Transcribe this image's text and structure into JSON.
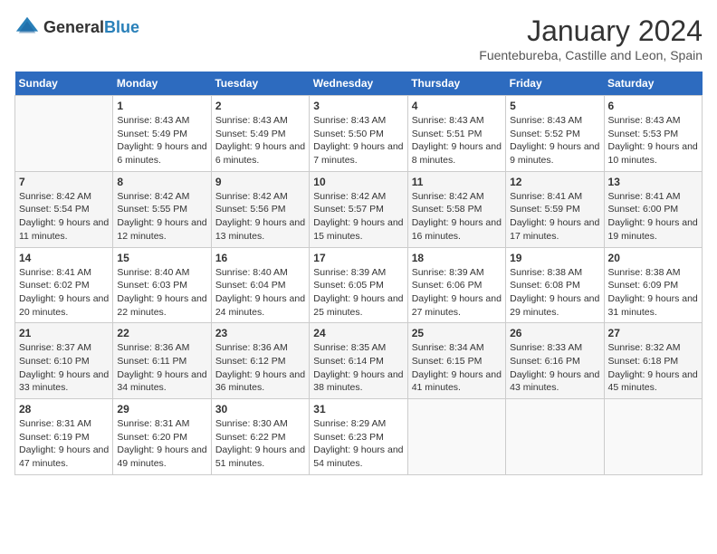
{
  "header": {
    "logo_general": "General",
    "logo_blue": "Blue",
    "month_title": "January 2024",
    "location": "Fuentebureba, Castille and Leon, Spain"
  },
  "days_of_week": [
    "Sunday",
    "Monday",
    "Tuesday",
    "Wednesday",
    "Thursday",
    "Friday",
    "Saturday"
  ],
  "weeks": [
    [
      {
        "day": "",
        "sunrise": "",
        "sunset": "",
        "daylight": ""
      },
      {
        "day": "1",
        "sunrise": "Sunrise: 8:43 AM",
        "sunset": "Sunset: 5:49 PM",
        "daylight": "Daylight: 9 hours and 6 minutes."
      },
      {
        "day": "2",
        "sunrise": "Sunrise: 8:43 AM",
        "sunset": "Sunset: 5:49 PM",
        "daylight": "Daylight: 9 hours and 6 minutes."
      },
      {
        "day": "3",
        "sunrise": "Sunrise: 8:43 AM",
        "sunset": "Sunset: 5:50 PM",
        "daylight": "Daylight: 9 hours and 7 minutes."
      },
      {
        "day": "4",
        "sunrise": "Sunrise: 8:43 AM",
        "sunset": "Sunset: 5:51 PM",
        "daylight": "Daylight: 9 hours and 8 minutes."
      },
      {
        "day": "5",
        "sunrise": "Sunrise: 8:43 AM",
        "sunset": "Sunset: 5:52 PM",
        "daylight": "Daylight: 9 hours and 9 minutes."
      },
      {
        "day": "6",
        "sunrise": "Sunrise: 8:43 AM",
        "sunset": "Sunset: 5:53 PM",
        "daylight": "Daylight: 9 hours and 10 minutes."
      }
    ],
    [
      {
        "day": "7",
        "sunrise": "Sunrise: 8:42 AM",
        "sunset": "Sunset: 5:54 PM",
        "daylight": "Daylight: 9 hours and 11 minutes."
      },
      {
        "day": "8",
        "sunrise": "Sunrise: 8:42 AM",
        "sunset": "Sunset: 5:55 PM",
        "daylight": "Daylight: 9 hours and 12 minutes."
      },
      {
        "day": "9",
        "sunrise": "Sunrise: 8:42 AM",
        "sunset": "Sunset: 5:56 PM",
        "daylight": "Daylight: 9 hours and 13 minutes."
      },
      {
        "day": "10",
        "sunrise": "Sunrise: 8:42 AM",
        "sunset": "Sunset: 5:57 PM",
        "daylight": "Daylight: 9 hours and 15 minutes."
      },
      {
        "day": "11",
        "sunrise": "Sunrise: 8:42 AM",
        "sunset": "Sunset: 5:58 PM",
        "daylight": "Daylight: 9 hours and 16 minutes."
      },
      {
        "day": "12",
        "sunrise": "Sunrise: 8:41 AM",
        "sunset": "Sunset: 5:59 PM",
        "daylight": "Daylight: 9 hours and 17 minutes."
      },
      {
        "day": "13",
        "sunrise": "Sunrise: 8:41 AM",
        "sunset": "Sunset: 6:00 PM",
        "daylight": "Daylight: 9 hours and 19 minutes."
      }
    ],
    [
      {
        "day": "14",
        "sunrise": "Sunrise: 8:41 AM",
        "sunset": "Sunset: 6:02 PM",
        "daylight": "Daylight: 9 hours and 20 minutes."
      },
      {
        "day": "15",
        "sunrise": "Sunrise: 8:40 AM",
        "sunset": "Sunset: 6:03 PM",
        "daylight": "Daylight: 9 hours and 22 minutes."
      },
      {
        "day": "16",
        "sunrise": "Sunrise: 8:40 AM",
        "sunset": "Sunset: 6:04 PM",
        "daylight": "Daylight: 9 hours and 24 minutes."
      },
      {
        "day": "17",
        "sunrise": "Sunrise: 8:39 AM",
        "sunset": "Sunset: 6:05 PM",
        "daylight": "Daylight: 9 hours and 25 minutes."
      },
      {
        "day": "18",
        "sunrise": "Sunrise: 8:39 AM",
        "sunset": "Sunset: 6:06 PM",
        "daylight": "Daylight: 9 hours and 27 minutes."
      },
      {
        "day": "19",
        "sunrise": "Sunrise: 8:38 AM",
        "sunset": "Sunset: 6:08 PM",
        "daylight": "Daylight: 9 hours and 29 minutes."
      },
      {
        "day": "20",
        "sunrise": "Sunrise: 8:38 AM",
        "sunset": "Sunset: 6:09 PM",
        "daylight": "Daylight: 9 hours and 31 minutes."
      }
    ],
    [
      {
        "day": "21",
        "sunrise": "Sunrise: 8:37 AM",
        "sunset": "Sunset: 6:10 PM",
        "daylight": "Daylight: 9 hours and 33 minutes."
      },
      {
        "day": "22",
        "sunrise": "Sunrise: 8:36 AM",
        "sunset": "Sunset: 6:11 PM",
        "daylight": "Daylight: 9 hours and 34 minutes."
      },
      {
        "day": "23",
        "sunrise": "Sunrise: 8:36 AM",
        "sunset": "Sunset: 6:12 PM",
        "daylight": "Daylight: 9 hours and 36 minutes."
      },
      {
        "day": "24",
        "sunrise": "Sunrise: 8:35 AM",
        "sunset": "Sunset: 6:14 PM",
        "daylight": "Daylight: 9 hours and 38 minutes."
      },
      {
        "day": "25",
        "sunrise": "Sunrise: 8:34 AM",
        "sunset": "Sunset: 6:15 PM",
        "daylight": "Daylight: 9 hours and 41 minutes."
      },
      {
        "day": "26",
        "sunrise": "Sunrise: 8:33 AM",
        "sunset": "Sunset: 6:16 PM",
        "daylight": "Daylight: 9 hours and 43 minutes."
      },
      {
        "day": "27",
        "sunrise": "Sunrise: 8:32 AM",
        "sunset": "Sunset: 6:18 PM",
        "daylight": "Daylight: 9 hours and 45 minutes."
      }
    ],
    [
      {
        "day": "28",
        "sunrise": "Sunrise: 8:31 AM",
        "sunset": "Sunset: 6:19 PM",
        "daylight": "Daylight: 9 hours and 47 minutes."
      },
      {
        "day": "29",
        "sunrise": "Sunrise: 8:31 AM",
        "sunset": "Sunset: 6:20 PM",
        "daylight": "Daylight: 9 hours and 49 minutes."
      },
      {
        "day": "30",
        "sunrise": "Sunrise: 8:30 AM",
        "sunset": "Sunset: 6:22 PM",
        "daylight": "Daylight: 9 hours and 51 minutes."
      },
      {
        "day": "31",
        "sunrise": "Sunrise: 8:29 AM",
        "sunset": "Sunset: 6:23 PM",
        "daylight": "Daylight: 9 hours and 54 minutes."
      },
      {
        "day": "",
        "sunrise": "",
        "sunset": "",
        "daylight": ""
      },
      {
        "day": "",
        "sunrise": "",
        "sunset": "",
        "daylight": ""
      },
      {
        "day": "",
        "sunrise": "",
        "sunset": "",
        "daylight": ""
      }
    ]
  ]
}
